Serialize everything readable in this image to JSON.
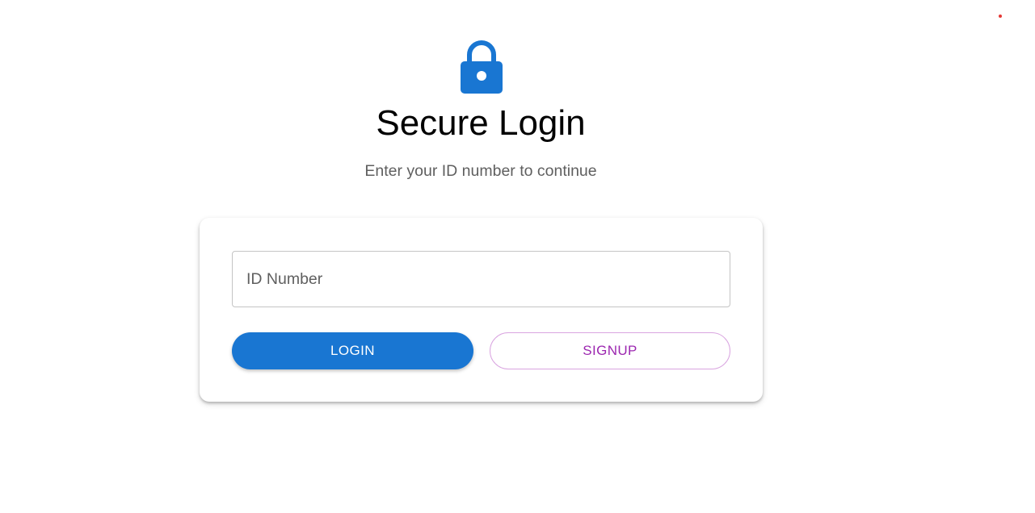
{
  "header": {
    "icon": "lock-icon",
    "title": "Secure Login",
    "subtitle": "Enter your ID number to continue"
  },
  "form": {
    "id_field": {
      "placeholder": "ID Number",
      "value": ""
    },
    "login_label": "LOGIN",
    "signup_label": "SIGNUP"
  },
  "colors": {
    "primary": "#1976d2",
    "secondary": "#9c27b0",
    "secondary_border": "#d9a4e0",
    "status_dot": "#e53935"
  }
}
